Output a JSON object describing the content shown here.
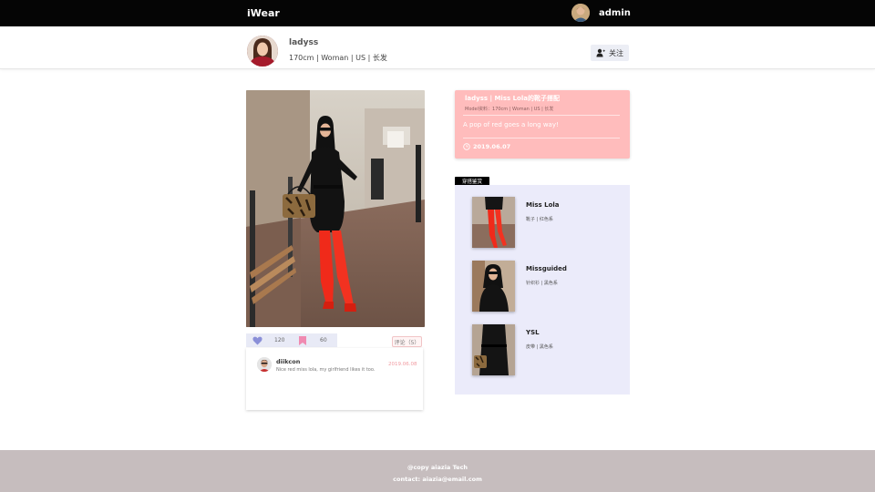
{
  "nav": {
    "brand": "iWear",
    "user": "admin"
  },
  "profile": {
    "name": "ladyss",
    "meta": "170cm | Woman | US | 长发",
    "follow_label": "关注"
  },
  "post": {
    "likes": "120",
    "saves": "60",
    "comments_label": "评论（5）"
  },
  "comments": [
    {
      "user": "diikcon",
      "text": "Nice red miss lola, my girlfriend likes it too.",
      "date": "2019.06.08"
    }
  ],
  "info": {
    "title": "ladyss  |  Miss Lola的靴子搭配",
    "sub": "Model资料：170cm | Woman | US | 长发",
    "desc": "A pop of red goes a long way!",
    "date": "2019.06.07"
  },
  "outfit": {
    "tag": "穿搭鉴赏",
    "items": [
      {
        "brand": "Miss Lola",
        "detail": "靴子 | 红色系"
      },
      {
        "brand": "Missguided",
        "detail": "针织衫 | 黑色系"
      },
      {
        "brand": "YSL",
        "detail": "皮带 | 黑色系"
      }
    ]
  },
  "footer": {
    "copy": "@copy aiazia Tech",
    "contact": "contact: aiazia@email.com"
  },
  "colors": {
    "accent_pink": "#ffbcbc",
    "panel_lavender": "#ebebfa",
    "like_icon": "#8a8fd8",
    "save_icon": "#f08ab1",
    "footer_bg": "#c6bdbe"
  }
}
